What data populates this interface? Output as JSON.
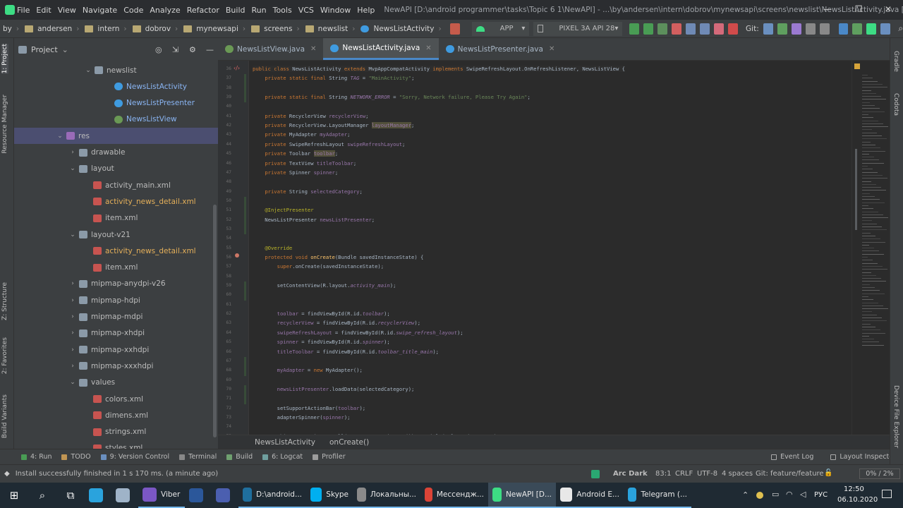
{
  "window": {
    "menus": [
      "File",
      "Edit",
      "View",
      "Navigate",
      "Code",
      "Analyze",
      "Refactor",
      "Build",
      "Run",
      "Tools",
      "VCS",
      "Window",
      "Help"
    ],
    "title": "NewAPI [D:\\android programmer\\tasks\\Topic 6 1\\NewAPI] - ...\\by\\andersen\\intern\\dobrov\\mynewsapi\\screens\\newslist\\NewsListActivity.java [app]"
  },
  "navbar": {
    "breadcrumbs": [
      "by",
      "andersen",
      "intern",
      "dobrov",
      "mynewsapi",
      "screens",
      "newslist",
      "NewsListActivity"
    ],
    "run_config": "APP",
    "device": "PIXEL 3A API 28",
    "git_label": "Git:"
  },
  "project_panel": {
    "title": "Project",
    "tree": [
      {
        "label": "newslist",
        "icon": "folder-icon",
        "kind": "folder"
      },
      {
        "label": "NewsListActivity",
        "icon": "class-icon",
        "kind": "file"
      },
      {
        "label": "NewsListPresenter",
        "icon": "class-icon",
        "kind": "file"
      },
      {
        "label": "NewsListView",
        "icon": "interface-icon",
        "kind": "file"
      },
      {
        "label": "res",
        "icon": "res-folder-icon",
        "kind": "folder"
      },
      {
        "label": "drawable",
        "icon": "folder-icon",
        "kind": "folder"
      },
      {
        "label": "layout",
        "icon": "folder-icon",
        "kind": "folder"
      },
      {
        "label": "activity_main.xml",
        "icon": "xml-icon",
        "kind": "file"
      },
      {
        "label": "activity_news_detail.xml",
        "icon": "xml-icon",
        "kind": "file"
      },
      {
        "label": "item.xml",
        "icon": "xml-icon",
        "kind": "file"
      },
      {
        "label": "layout-v21",
        "icon": "folder-icon",
        "kind": "folder"
      },
      {
        "label": "activity_news_detail.xml",
        "icon": "xml-icon",
        "kind": "file"
      },
      {
        "label": "item.xml",
        "icon": "xml-icon",
        "kind": "file"
      },
      {
        "label": "mipmap-anydpi-v26",
        "icon": "folder-icon",
        "kind": "folder"
      },
      {
        "label": "mipmap-hdpi",
        "icon": "folder-icon",
        "kind": "folder"
      },
      {
        "label": "mipmap-mdpi",
        "icon": "folder-icon",
        "kind": "folder"
      },
      {
        "label": "mipmap-xhdpi",
        "icon": "folder-icon",
        "kind": "folder"
      },
      {
        "label": "mipmap-xxhdpi",
        "icon": "folder-icon",
        "kind": "folder"
      },
      {
        "label": "mipmap-xxxhdpi",
        "icon": "folder-icon",
        "kind": "folder"
      },
      {
        "label": "values",
        "icon": "folder-icon",
        "kind": "folder"
      },
      {
        "label": "colors.xml",
        "icon": "xml-icon",
        "kind": "file"
      },
      {
        "label": "dimens.xml",
        "icon": "xml-icon",
        "kind": "file"
      },
      {
        "label": "strings.xml",
        "icon": "xml-icon",
        "kind": "file"
      },
      {
        "label": "styles.xml",
        "icon": "xml-icon",
        "kind": "file"
      }
    ]
  },
  "left_strip": [
    "1: Project",
    "Resource Manager",
    "Z: Structure",
    "2: Favorites",
    "Build Variants"
  ],
  "right_strip": [
    "Gradle",
    "Codota",
    "Device File Explorer"
  ],
  "editor": {
    "tabs": [
      {
        "label": "NewsListView.java",
        "icon": "interface-icon"
      },
      {
        "label": "NewsListActivity.java",
        "icon": "class-icon"
      },
      {
        "label": "NewsListPresenter.java",
        "icon": "class-icon"
      }
    ],
    "line_numbers": [
      "36",
      "37",
      "38",
      "39",
      "40",
      "41",
      "42",
      "43",
      "44",
      "45",
      "46",
      "47",
      "48",
      "49",
      "50",
      "51",
      "52",
      "53",
      "54",
      "55",
      "56",
      "57",
      "58",
      "59",
      "60",
      "61",
      "62",
      "63",
      "64",
      "65",
      "66",
      "67",
      "68",
      "69",
      "70",
      "71",
      "72",
      "73",
      "74",
      "75"
    ],
    "code_lines": [
      "public class NewsListActivity extends MvpAppCompatActivity implements SwipeRefreshLayout.OnRefreshListener, NewsListView {",
      "    private static final String TAG = \"MainActivity\";",
      "",
      "    private static final String NETWORK_ERROR = \"Sorry, Network failure, Please Try Again\";",
      "",
      "    private RecyclerView recyclerView;",
      "    private RecyclerView.LayoutManager layoutManager;",
      "    private MyAdapter myAdapter;",
      "    private SwipeRefreshLayout swipeRefreshLayout;",
      "    private Toolbar toolbar;",
      "    private TextView titleToolbar;",
      "    private Spinner spinner;",
      "",
      "    private String selectedCategory;",
      "",
      "    @InjectPresenter",
      "    NewsListPresenter newsListPresenter;",
      "",
      "",
      "    @Override",
      "    protected void onCreate(Bundle savedInstanceState) {",
      "        super.onCreate(savedInstanceState);",
      "",
      "        setContentView(R.layout.activity_main);",
      "",
      "",
      "        toolbar = findViewById(R.id.toolbar);",
      "        recyclerView = findViewById(R.id.recyclerView);",
      "        swipeRefreshLayout = findViewById(R.id.swipe_refresh_layout);",
      "        spinner = findViewById(R.id.spinner);",
      "        titleToolbar = findViewById(R.id.toolbar_title_main);",
      "",
      "        myAdapter = new MyAdapter();",
      "",
      "        newsListPresenter.loadData(selectedCategory);",
      "",
      "        setSupportActionBar(toolbar);",
      "        adapterSpinner(spinner);",
      "",
      "        Objects.requireNonNull(getSupportActionBar()).setTitle(selectedCategory);"
    ],
    "breadcrumb": [
      "NewsListActivity",
      "onCreate()"
    ]
  },
  "tool_windows": {
    "left": [
      "4: Run",
      "TODO",
      "9: Version Control",
      "Terminal",
      "Build",
      "6: Logcat",
      "Profiler"
    ],
    "right": [
      "Event Log",
      "Layout Inspector"
    ]
  },
  "status": {
    "message": "Install successfully finished in 1 s 170 ms. (a minute ago)",
    "theme": "Arc Dark",
    "position": "83:1",
    "line_sep": "CRLF",
    "encoding": "UTF-8",
    "indent": "4 spaces",
    "branch": "Git: feature/feature",
    "progress": "0% / 2%"
  },
  "taskbar": {
    "items": [
      {
        "label": "",
        "icon": "windows-icon"
      },
      {
        "label": "",
        "icon": "search-icon"
      },
      {
        "label": "",
        "icon": "task-view-icon"
      },
      {
        "label": "",
        "icon": "telegram-icon"
      },
      {
        "label": "",
        "icon": "notepad-icon"
      },
      {
        "label": "Viber",
        "icon": "viber-icon"
      },
      {
        "label": "",
        "icon": "word-icon"
      },
      {
        "label": "",
        "icon": "save-app-icon"
      },
      {
        "label": "D:\\android...",
        "icon": "powershell-icon"
      },
      {
        "label": "Skype",
        "icon": "skype-icon"
      },
      {
        "label": "Локальны...",
        "icon": "drive-icon"
      },
      {
        "label": "Мессендж...",
        "icon": "chrome-icon"
      },
      {
        "label": "NewAPI [D...",
        "icon": "android-studio-icon"
      },
      {
        "label": "Android E...",
        "icon": "android-emulator-icon"
      },
      {
        "label": "Telegram (...",
        "icon": "telegram-icon"
      }
    ],
    "lang": "РУС",
    "time": "12:50",
    "date": "06.10.2020"
  },
  "colors": {
    "accent": "#4a88c7",
    "selection": "#4b4e70",
    "keyword": "#cc7832",
    "string": "#6a8759",
    "field": "#9876aa"
  }
}
